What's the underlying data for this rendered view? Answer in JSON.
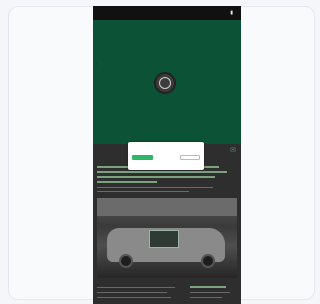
{
  "status_bar": {
    "left_text": "",
    "right_icon": "battery-icon"
  },
  "video": {
    "background_color": "#0c5236",
    "loader_icon": "loading-spinner-icon",
    "side_icon": "chevron-left-icon"
  },
  "article": {
    "icon": "share-icon",
    "accent_color": "#7aa281"
  },
  "consent_dialog": {
    "title": "",
    "subtitle": "",
    "accept_label": "",
    "reject_label": "",
    "manage_label": "",
    "links": "",
    "accept_color": "#2fb56a"
  }
}
